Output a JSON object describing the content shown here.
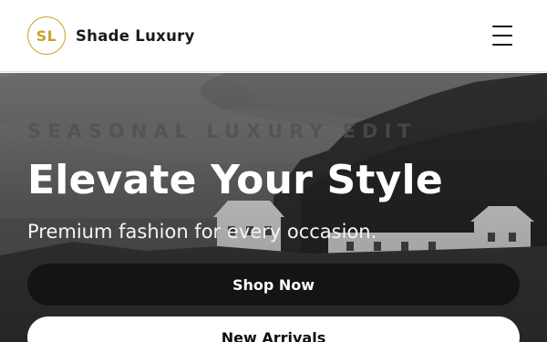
{
  "header": {
    "logo_initials": "SL",
    "brand_name": "Shade Luxury",
    "menu_icon": "hamburger-menu-icon"
  },
  "hero": {
    "eyebrow": "SEASONAL LUXURY EDIT",
    "headline": "Elevate Your Style",
    "subline": "Premium fashion for every occasion.",
    "primary_cta": "Shop Now",
    "secondary_cta": "New Arrivals"
  },
  "colors": {
    "accent_gold": "#c9a227",
    "primary_button": "#141414",
    "secondary_button": "#ffffff"
  }
}
